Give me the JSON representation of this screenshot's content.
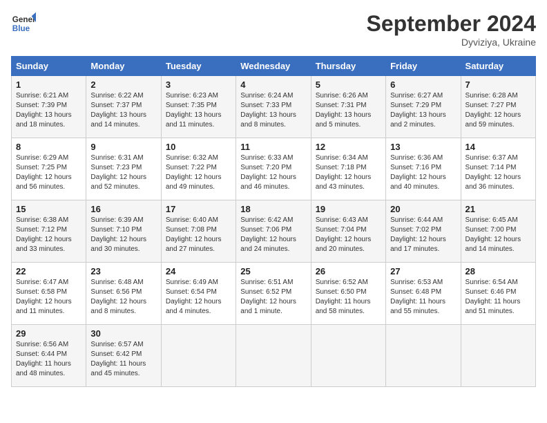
{
  "header": {
    "logo_line1": "General",
    "logo_line2": "Blue",
    "month_title": "September 2024",
    "location": "Dyviziya, Ukraine"
  },
  "weekdays": [
    "Sunday",
    "Monday",
    "Tuesday",
    "Wednesday",
    "Thursday",
    "Friday",
    "Saturday"
  ],
  "weeks": [
    [
      {
        "day": "1",
        "sunrise": "Sunrise: 6:21 AM",
        "sunset": "Sunset: 7:39 PM",
        "daylight": "Daylight: 13 hours and 18 minutes."
      },
      {
        "day": "2",
        "sunrise": "Sunrise: 6:22 AM",
        "sunset": "Sunset: 7:37 PM",
        "daylight": "Daylight: 13 hours and 14 minutes."
      },
      {
        "day": "3",
        "sunrise": "Sunrise: 6:23 AM",
        "sunset": "Sunset: 7:35 PM",
        "daylight": "Daylight: 13 hours and 11 minutes."
      },
      {
        "day": "4",
        "sunrise": "Sunrise: 6:24 AM",
        "sunset": "Sunset: 7:33 PM",
        "daylight": "Daylight: 13 hours and 8 minutes."
      },
      {
        "day": "5",
        "sunrise": "Sunrise: 6:26 AM",
        "sunset": "Sunset: 7:31 PM",
        "daylight": "Daylight: 13 hours and 5 minutes."
      },
      {
        "day": "6",
        "sunrise": "Sunrise: 6:27 AM",
        "sunset": "Sunset: 7:29 PM",
        "daylight": "Daylight: 13 hours and 2 minutes."
      },
      {
        "day": "7",
        "sunrise": "Sunrise: 6:28 AM",
        "sunset": "Sunset: 7:27 PM",
        "daylight": "Daylight: 12 hours and 59 minutes."
      }
    ],
    [
      {
        "day": "8",
        "sunrise": "Sunrise: 6:29 AM",
        "sunset": "Sunset: 7:25 PM",
        "daylight": "Daylight: 12 hours and 56 minutes."
      },
      {
        "day": "9",
        "sunrise": "Sunrise: 6:31 AM",
        "sunset": "Sunset: 7:23 PM",
        "daylight": "Daylight: 12 hours and 52 minutes."
      },
      {
        "day": "10",
        "sunrise": "Sunrise: 6:32 AM",
        "sunset": "Sunset: 7:22 PM",
        "daylight": "Daylight: 12 hours and 49 minutes."
      },
      {
        "day": "11",
        "sunrise": "Sunrise: 6:33 AM",
        "sunset": "Sunset: 7:20 PM",
        "daylight": "Daylight: 12 hours and 46 minutes."
      },
      {
        "day": "12",
        "sunrise": "Sunrise: 6:34 AM",
        "sunset": "Sunset: 7:18 PM",
        "daylight": "Daylight: 12 hours and 43 minutes."
      },
      {
        "day": "13",
        "sunrise": "Sunrise: 6:36 AM",
        "sunset": "Sunset: 7:16 PM",
        "daylight": "Daylight: 12 hours and 40 minutes."
      },
      {
        "day": "14",
        "sunrise": "Sunrise: 6:37 AM",
        "sunset": "Sunset: 7:14 PM",
        "daylight": "Daylight: 12 hours and 36 minutes."
      }
    ],
    [
      {
        "day": "15",
        "sunrise": "Sunrise: 6:38 AM",
        "sunset": "Sunset: 7:12 PM",
        "daylight": "Daylight: 12 hours and 33 minutes."
      },
      {
        "day": "16",
        "sunrise": "Sunrise: 6:39 AM",
        "sunset": "Sunset: 7:10 PM",
        "daylight": "Daylight: 12 hours and 30 minutes."
      },
      {
        "day": "17",
        "sunrise": "Sunrise: 6:40 AM",
        "sunset": "Sunset: 7:08 PM",
        "daylight": "Daylight: 12 hours and 27 minutes."
      },
      {
        "day": "18",
        "sunrise": "Sunrise: 6:42 AM",
        "sunset": "Sunset: 7:06 PM",
        "daylight": "Daylight: 12 hours and 24 minutes."
      },
      {
        "day": "19",
        "sunrise": "Sunrise: 6:43 AM",
        "sunset": "Sunset: 7:04 PM",
        "daylight": "Daylight: 12 hours and 20 minutes."
      },
      {
        "day": "20",
        "sunrise": "Sunrise: 6:44 AM",
        "sunset": "Sunset: 7:02 PM",
        "daylight": "Daylight: 12 hours and 17 minutes."
      },
      {
        "day": "21",
        "sunrise": "Sunrise: 6:45 AM",
        "sunset": "Sunset: 7:00 PM",
        "daylight": "Daylight: 12 hours and 14 minutes."
      }
    ],
    [
      {
        "day": "22",
        "sunrise": "Sunrise: 6:47 AM",
        "sunset": "Sunset: 6:58 PM",
        "daylight": "Daylight: 12 hours and 11 minutes."
      },
      {
        "day": "23",
        "sunrise": "Sunrise: 6:48 AM",
        "sunset": "Sunset: 6:56 PM",
        "daylight": "Daylight: 12 hours and 8 minutes."
      },
      {
        "day": "24",
        "sunrise": "Sunrise: 6:49 AM",
        "sunset": "Sunset: 6:54 PM",
        "daylight": "Daylight: 12 hours and 4 minutes."
      },
      {
        "day": "25",
        "sunrise": "Sunrise: 6:51 AM",
        "sunset": "Sunset: 6:52 PM",
        "daylight": "Daylight: 12 hours and 1 minute."
      },
      {
        "day": "26",
        "sunrise": "Sunrise: 6:52 AM",
        "sunset": "Sunset: 6:50 PM",
        "daylight": "Daylight: 11 hours and 58 minutes."
      },
      {
        "day": "27",
        "sunrise": "Sunrise: 6:53 AM",
        "sunset": "Sunset: 6:48 PM",
        "daylight": "Daylight: 11 hours and 55 minutes."
      },
      {
        "day": "28",
        "sunrise": "Sunrise: 6:54 AM",
        "sunset": "Sunset: 6:46 PM",
        "daylight": "Daylight: 11 hours and 51 minutes."
      }
    ],
    [
      {
        "day": "29",
        "sunrise": "Sunrise: 6:56 AM",
        "sunset": "Sunset: 6:44 PM",
        "daylight": "Daylight: 11 hours and 48 minutes."
      },
      {
        "day": "30",
        "sunrise": "Sunrise: 6:57 AM",
        "sunset": "Sunset: 6:42 PM",
        "daylight": "Daylight: 11 hours and 45 minutes."
      },
      null,
      null,
      null,
      null,
      null
    ]
  ]
}
